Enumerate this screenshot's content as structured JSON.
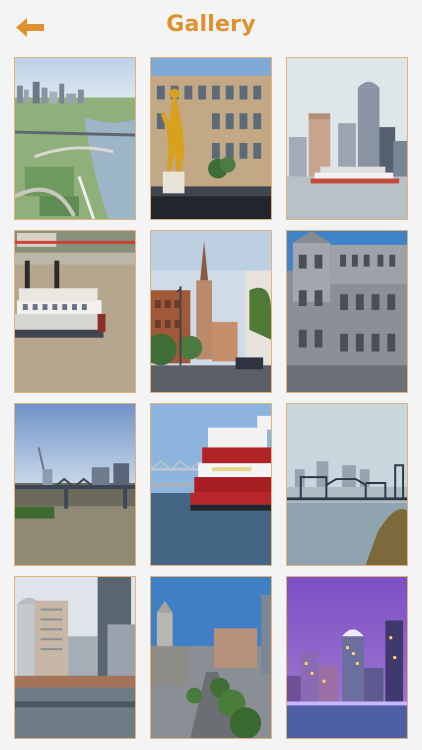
{
  "header": {
    "title": "Gallery",
    "back_icon": "back-arrow-icon"
  },
  "accent": "#e0912f",
  "border": "#e0b27d",
  "gallery": {
    "photos": [
      {
        "subject": "aerial-skyline-park"
      },
      {
        "subject": "gold-statue-building"
      },
      {
        "subject": "skyline-riverboat"
      },
      {
        "subject": "paddle-steamer"
      },
      {
        "subject": "church-spire-street"
      },
      {
        "subject": "victorian-facade"
      },
      {
        "subject": "bridge-industrial-river"
      },
      {
        "subject": "red-sternwheeler-bridge"
      },
      {
        "subject": "bridge-river-skyline"
      },
      {
        "subject": "downtown-towers"
      },
      {
        "subject": "boulevard-clock-tower"
      },
      {
        "subject": "night-skyline-purple"
      }
    ]
  }
}
